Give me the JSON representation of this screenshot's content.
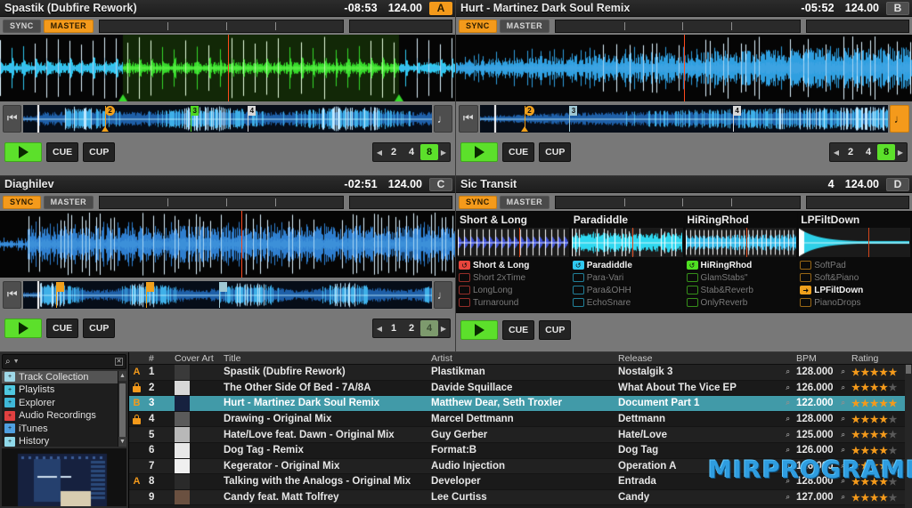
{
  "decks": [
    {
      "id": "A",
      "letter": "A",
      "letter_active": true,
      "title": "Spastik (Dubfire Rework)",
      "time": "-08:53",
      "bpm": "124.00",
      "sync_label": "SYNC",
      "master_label": "MASTER",
      "sync_active": false,
      "master_active": true,
      "play_label": "play",
      "cue_label": "CUE",
      "cup_label": "CUP",
      "loop_sizes": [
        "2",
        "4",
        "8"
      ],
      "loop_selected": "8",
      "loop_dim": false,
      "has_loop_selector": true,
      "wave_color": "#2fc8f0",
      "loop_region_color": "#35d92a",
      "cues": [
        {
          "label": "2",
          "pos": 20,
          "color": "#f0a01c",
          "shape": "round"
        },
        {
          "label": "3",
          "pos": 41,
          "color": "#4fd622",
          "shape": "square"
        },
        {
          "label": "4",
          "pos": 55,
          "color": "#d8d8d8",
          "shape": "flag"
        }
      ],
      "end_btn": "note",
      "end_btn_active": false
    },
    {
      "id": "B",
      "letter": "B",
      "letter_active": false,
      "title": "Hurt - Martinez Dark Soul Remix",
      "time": "-05:52",
      "bpm": "124.00",
      "sync_label": "SYNC",
      "master_label": "MASTER",
      "sync_active": true,
      "master_active": false,
      "play_label": "play",
      "cue_label": "CUE",
      "cup_label": "CUP",
      "loop_sizes": [
        "2",
        "4",
        "8"
      ],
      "loop_selected": "8",
      "loop_dim": false,
      "has_loop_selector": true,
      "wave_color": "#2f9fe0",
      "loop_region_color": null,
      "cues": [
        {
          "label": "2",
          "pos": 11,
          "color": "#f0a01c",
          "shape": "round"
        },
        {
          "label": "3",
          "pos": 22,
          "color": "#9fc8d4",
          "shape": "flag"
        },
        {
          "label": "4",
          "pos": 62,
          "color": "#d8d8d8",
          "shape": "flag"
        }
      ],
      "end_btn": "note",
      "end_btn_active": true
    },
    {
      "id": "C",
      "letter": "C",
      "letter_active": false,
      "title": "Diaghilev",
      "time": "-02:51",
      "bpm": "124.00",
      "sync_label": "SYNC",
      "master_label": "MASTER",
      "sync_active": true,
      "master_active": false,
      "play_label": "play",
      "cue_label": "CUE",
      "cup_label": "CUP",
      "loop_sizes": [
        "1",
        "2",
        "4"
      ],
      "loop_selected": "4",
      "loop_dim": true,
      "has_loop_selector": true,
      "wave_color": "#2f7fd0",
      "loop_region_color": null,
      "cues": [
        {
          "label": "",
          "pos": 8,
          "color": "#f0a01c",
          "shape": "flag"
        },
        {
          "label": "",
          "pos": 30,
          "color": "#f0a01c",
          "shape": "flag"
        },
        {
          "label": "",
          "pos": 48,
          "color": "#9fc8d4",
          "shape": "flag"
        }
      ],
      "end_btn": "note",
      "end_btn_active": false
    },
    {
      "id": "D",
      "letter": "D",
      "letter_active": false,
      "title": "Sic Transit",
      "time": "4",
      "bpm": "124.00",
      "sync_label": "SYNC",
      "master_label": "MASTER",
      "sync_active": true,
      "master_active": false,
      "play_label": "play",
      "cue_label": "CUE",
      "cup_label": "CUP",
      "loop_sizes": [],
      "loop_selected": "",
      "loop_dim": false,
      "has_loop_selector": false,
      "wave_color": null,
      "loop_region_color": null,
      "cues": [],
      "end_btn": null,
      "end_btn_active": false
    }
  ],
  "sampler": {
    "slots": [
      {
        "name": "Short & Long",
        "color": "#e8453c",
        "wave_color": "#3b4fd8",
        "items": [
          {
            "label": "Short & Long",
            "active": true,
            "icon": "loop-icon"
          },
          {
            "label": "Short 2xTime",
            "active": false,
            "icon": "loop-icon"
          },
          {
            "label": "LongLong",
            "active": false,
            "icon": "loop-icon"
          },
          {
            "label": "Turnaround",
            "active": false,
            "icon": "loop-icon"
          }
        ]
      },
      {
        "name": "Paradiddle",
        "color": "#2fc8f0",
        "wave_color": "#2fd8f0",
        "items": [
          {
            "label": "Paradiddle",
            "active": true,
            "icon": "loop-icon"
          },
          {
            "label": "Para-Vari",
            "active": false,
            "icon": "loop-icon"
          },
          {
            "label": "Para&OHH",
            "active": false,
            "icon": "loop-icon"
          },
          {
            "label": "EchoSnare",
            "active": false,
            "icon": "loop-icon"
          }
        ]
      },
      {
        "name": "HiRingRhod",
        "color": "#4fe022",
        "wave_color": "#2fb8e8",
        "items": [
          {
            "label": "HiRingRhod",
            "active": true,
            "icon": "loop-icon"
          },
          {
            "label": "GlamStabs\"",
            "active": false,
            "icon": "loop-icon"
          },
          {
            "label": "Stab&Reverb",
            "active": false,
            "icon": "loop-icon"
          },
          {
            "label": "OnlyReverb",
            "active": false,
            "icon": "loop-icon"
          }
        ]
      },
      {
        "name": "LPFiltDown",
        "color": "#f0a01c",
        "wave_color": "#2fd0e8",
        "items": [
          {
            "label": "SoftPad",
            "active": false,
            "icon": "oneshot-icon"
          },
          {
            "label": "Soft&Piano",
            "active": false,
            "icon": "oneshot-icon"
          },
          {
            "label": "LPFiltDown",
            "active": true,
            "icon": "oneshot-icon"
          },
          {
            "label": "PianoDrops",
            "active": false,
            "icon": "oneshot-icon"
          }
        ]
      }
    ]
  },
  "browser": {
    "search": {
      "placeholder": "",
      "value": ""
    },
    "tree": {
      "items": [
        {
          "label": "Track Collection",
          "selected": true,
          "icon": "collection-icon",
          "color": "#9fd8e8"
        },
        {
          "label": "Playlists",
          "selected": false,
          "icon": "playlist-icon",
          "color": "#4fc8e0"
        },
        {
          "label": "Explorer",
          "selected": false,
          "icon": "explorer-icon",
          "color": "#3fb8d8"
        },
        {
          "label": "Audio Recordings",
          "selected": false,
          "icon": "record-icon",
          "color": "#e04040"
        },
        {
          "label": "iTunes",
          "selected": false,
          "icon": "itunes-icon",
          "color": "#4f9fe0"
        },
        {
          "label": "History",
          "selected": false,
          "icon": "history-icon",
          "color": "#8fd8e8"
        }
      ]
    },
    "columns": [
      "",
      "#",
      "Cover Art",
      "Title",
      "Artist",
      "Release",
      "BPM",
      "Rating"
    ],
    "rows": [
      {
        "deck": "A",
        "num": "1",
        "title": "Spastik (Dubfire Rework)",
        "artist": "Plastikman",
        "release": "Nostalgik 3",
        "bpm": "128.000",
        "rating": 5,
        "selected": false,
        "cover": "#3a3a3a"
      },
      {
        "deck": "lock",
        "num": "2",
        "title": "The Other Side Of Bed - 7A/8A",
        "artist": "Davide Squillace",
        "release": "What About The Vice EP",
        "bpm": "126.000",
        "rating": 4,
        "selected": false,
        "cover": "#d8d8d8"
      },
      {
        "deck": "B",
        "num": "3",
        "title": "Hurt - Martinez Dark Soul Remix",
        "artist": "Matthew Dear, Seth Troxler",
        "release": "Document Part 1",
        "bpm": "122.000",
        "rating": 5,
        "selected": true,
        "cover": "#16213f"
      },
      {
        "deck": "lock",
        "num": "4",
        "title": "Drawing - Original Mix",
        "artist": "Marcel Dettmann",
        "release": "Dettmann",
        "bpm": "128.000",
        "rating": 4,
        "selected": false,
        "cover": "#5a5a5a"
      },
      {
        "deck": "",
        "num": "5",
        "title": "Hate/Love feat. Dawn - Original Mix",
        "artist": "Guy Gerber",
        "release": "Hate/Love",
        "bpm": "125.000",
        "rating": 4,
        "selected": false,
        "cover": "#b8b8b8"
      },
      {
        "deck": "",
        "num": "6",
        "title": "Dog Tag - Remix",
        "artist": "Format:B",
        "release": "Dog Tag",
        "bpm": "126.000",
        "rating": 4,
        "selected": false,
        "cover": "#e8e8e8"
      },
      {
        "deck": "",
        "num": "7",
        "title": "Kegerator - Original Mix",
        "artist": "Audio Injection",
        "release": "Operation A",
        "bpm": "126.000",
        "rating": 4,
        "selected": false,
        "cover": "#f0f0f0"
      },
      {
        "deck": "A",
        "num": "8",
        "title": "Talking with the Analogs - Original Mix",
        "artist": "Developer",
        "release": "Entrada",
        "bpm": "128.000",
        "rating": 4,
        "selected": false,
        "cover": "#2a2a2a"
      },
      {
        "deck": "",
        "num": "9",
        "title": "Candy feat. Matt Tolfrey",
        "artist": "Lee Curtiss",
        "release": "Candy",
        "bpm": "127.000",
        "rating": 4,
        "selected": false,
        "cover": "#6a5040"
      }
    ]
  },
  "watermark": {
    "text": "MIRPROGRAMM.RU",
    "color": "#2f9de0"
  }
}
